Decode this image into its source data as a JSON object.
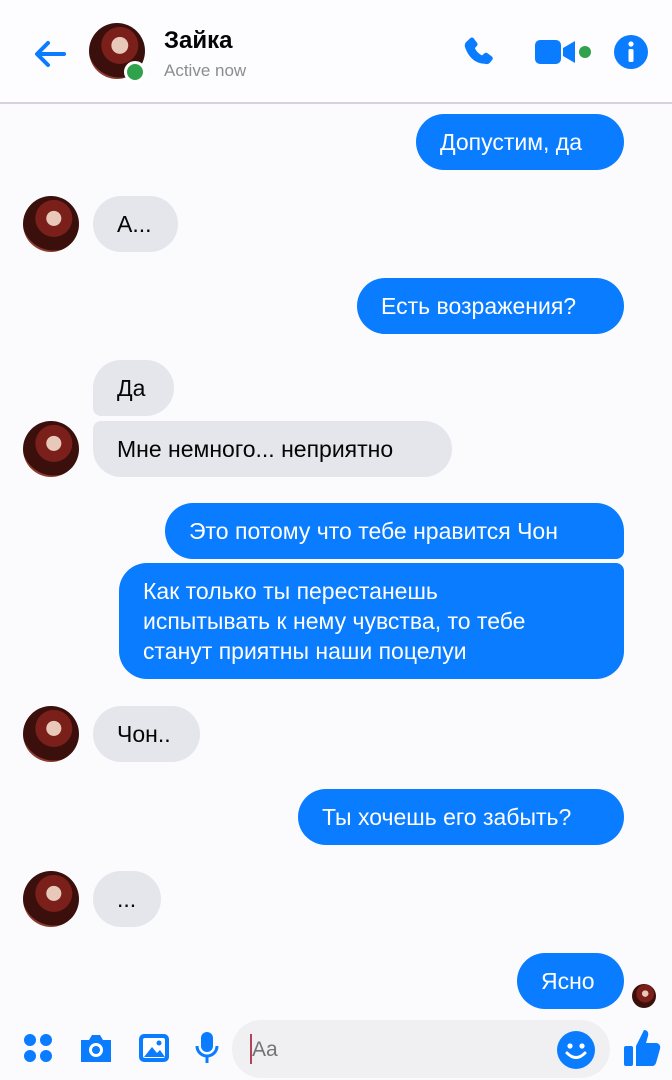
{
  "header": {
    "back_icon": "arrow-left-icon",
    "contact_name": "Зайка",
    "status": "Active now",
    "accent_color": "#0a7cff",
    "online_color": "#31a24c"
  },
  "messages": [
    {
      "sender": "me",
      "text": "Допустим, да"
    },
    {
      "sender": "them",
      "text": "А..."
    },
    {
      "sender": "me",
      "text": "Есть возражения?"
    },
    {
      "sender": "them",
      "text": "Да"
    },
    {
      "sender": "them",
      "text": "Мне немного... неприятно"
    },
    {
      "sender": "me",
      "text": "Это потому что тебе нравится Чон"
    },
    {
      "sender": "me",
      "lines": [
        "Как только ты перестанешь",
        "испытывать к нему чувства, то тебе",
        "станут приятны наши поцелуи"
      ]
    },
    {
      "sender": "them",
      "text": "Чон.."
    },
    {
      "sender": "me",
      "text": "Ты хочешь его забыть?"
    },
    {
      "sender": "them",
      "text": "..."
    },
    {
      "sender": "me",
      "text": "Ясно"
    }
  ],
  "composer": {
    "placeholder": "Aa"
  },
  "icons": {
    "header": [
      "phone-icon",
      "video-camera-icon",
      "info-icon"
    ],
    "bottom": [
      "apps-grid-icon",
      "camera-icon",
      "image-icon",
      "microphone-icon",
      "emoji-icon",
      "thumbs-up-icon"
    ]
  }
}
